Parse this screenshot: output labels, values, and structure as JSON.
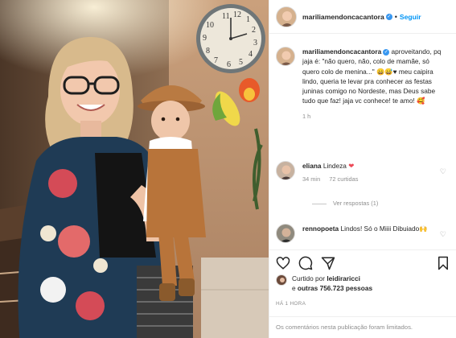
{
  "colors": {
    "accent": "#0095f6",
    "verified": "#3897f0",
    "heart_red": "#ed4956",
    "muted_text": "#8e8e8e"
  },
  "photo": {
    "subject": "woman holding baby",
    "clock_numbers": [
      "11",
      "12",
      "1",
      "2",
      "9",
      "10",
      "8",
      "3",
      "7",
      "6",
      "5",
      "4"
    ]
  },
  "header": {
    "username": "mariliamendoncacantora",
    "separator": "•",
    "follow_label": "Seguir"
  },
  "caption": {
    "username": "mariliamendoncacantora",
    "text": " aproveitando, pq jaja é: \"não quero, não, colo de mamãe, só quero colo de menina...\" 😄😅♥ meu caipira lindo, queria te levar pra conhecer as festas juninas comigo no Nordeste, mas Deus sabe tudo que faz! jaja vc conhece! te amo! 🥰",
    "time": "1 h"
  },
  "comments": [
    {
      "username": "eliana",
      "text": " Lindeza",
      "emoji": "❤",
      "time": "34 min",
      "likes": "72 curtidas",
      "view_replies": "Ver respostas (1)"
    },
    {
      "username": "rennopoeta",
      "text": " Lindos! Só o Miiii Dibuiado",
      "emoji": "🙌",
      "time": "",
      "likes": ""
    }
  ],
  "actions": {
    "like_icon": "heart-outline-icon",
    "comment_icon": "comment-bubble-icon",
    "share_icon": "paper-plane-icon",
    "save_icon": "bookmark-icon"
  },
  "likes": {
    "prefix": "Curtido por ",
    "user": "leidiraricci",
    "middle": " e ",
    "others": "outras 756.723 pessoas"
  },
  "posted_time": "HÁ 1 HORA",
  "footer": {
    "limited_comments": "Os comentários nesta publicação foram limitados."
  }
}
